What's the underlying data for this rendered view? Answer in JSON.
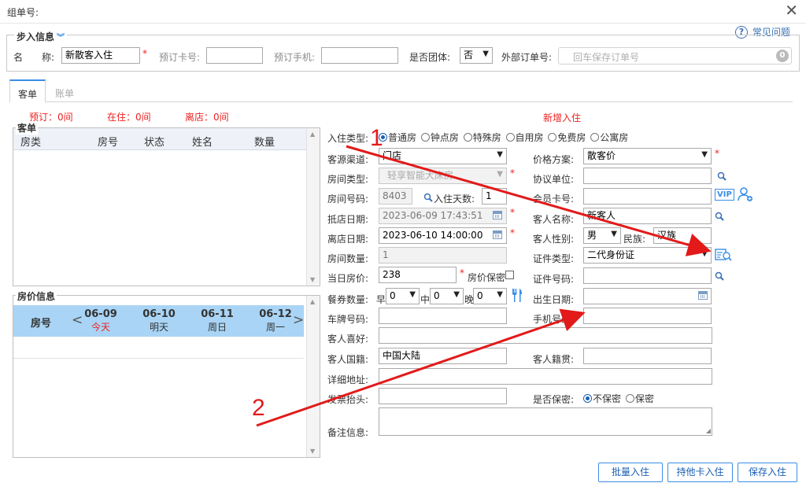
{
  "window": {
    "title": "组单号:"
  },
  "help": {
    "label": "常见问题"
  },
  "step_in": {
    "legend": "步入信息",
    "name_label": "名　　称:",
    "name_value": "新散客入住",
    "reserve_card_label": "预订卡号:",
    "reserve_phone_label": "预订手机:",
    "is_group_label": "是否团体:",
    "is_group_value": "否",
    "ext_order_label": "外部订单号:",
    "ext_order_placeholder": "回车保存订单号",
    "ext_order_count": "0"
  },
  "tabs": [
    {
      "label": "客单"
    },
    {
      "label": "账单"
    }
  ],
  "stats": {
    "reserved": "预订：0间",
    "in_house": "在住：0间",
    "departed": "离店：0间"
  },
  "new_checkin_label": "新增入住",
  "guest_panel": {
    "title": "客单",
    "columns": [
      "房类",
      "房号",
      "状态",
      "姓名",
      "数量"
    ]
  },
  "price_panel": {
    "title": "房价信息",
    "room_no_label": "房号",
    "days": [
      {
        "date": "06-09",
        "weekday": "今天",
        "today": true
      },
      {
        "date": "06-10",
        "weekday": "明天",
        "today": false
      },
      {
        "date": "06-11",
        "weekday": "周日",
        "today": false
      },
      {
        "date": "06-12",
        "weekday": "周一",
        "today": false
      }
    ]
  },
  "form": {
    "checkin_type_label": "入住类型:",
    "checkin_types": [
      "普通房",
      "钟点房",
      "特殊房",
      "自用房",
      "免费房",
      "公寓房"
    ],
    "checkin_type_selected": "普通房",
    "source_label": "客源渠道:",
    "source_value": "门店",
    "room_type_label": "房间类型:",
    "room_type_value": "轻享智能大床房",
    "room_no_label": "房间号码:",
    "room_no_value": "8403",
    "days_label": "入住天数:",
    "days_value": "1",
    "arrive_label": "抵店日期:",
    "arrive_value": "2023-06-09 17:43:51",
    "depart_label": "离店日期:",
    "depart_value": "2023-06-10 14:00:00",
    "room_count_label": "房间数量:",
    "room_count_value": "1",
    "day_price_label": "当日房价:",
    "day_price_value": "238",
    "price_secret_label": "房价保密",
    "meal_label": "餐券数量:",
    "breakfast_label": "早",
    "lunch_label": "中",
    "dinner_label": "晚",
    "meal_values": [
      "0",
      "0",
      "0"
    ],
    "plate_label": "车牌号码:",
    "hobby_label": "客人喜好:",
    "nationality_label": "客人国籍:",
    "nationality_value": "中国大陆",
    "address_label": "详细地址:",
    "invoice_label": "发票抬头:",
    "remark_label": "备注信息:",
    "price_plan_label": "价格方案:",
    "price_plan_value": "散客价",
    "agreement_label": "协议单位:",
    "member_card_label": "会员卡号:",
    "vip_label": "VIP",
    "guest_name_label": "客人名称:",
    "guest_name_value": "新客人",
    "gender_label": "客人性别:",
    "gender_value": "男",
    "ethnic_label": "民族:",
    "ethnic_value": "汉族",
    "id_type_label": "证件类型:",
    "id_type_value": "二代身份证",
    "id_no_label": "证件号码:",
    "birth_label": "出生日期:",
    "mobile_label": "手机号码:",
    "origin_label": "客人籍贯:",
    "secret_label": "是否保密:",
    "secret_options": [
      "不保密",
      "保密"
    ],
    "secret_selected": "不保密"
  },
  "buttons": {
    "batch": "批量入住",
    "other_card": "持他卡入住",
    "save": "保存入住"
  },
  "annotations": {
    "num1": "1",
    "num2": "2",
    "arrow_color": "#e21a1a"
  }
}
